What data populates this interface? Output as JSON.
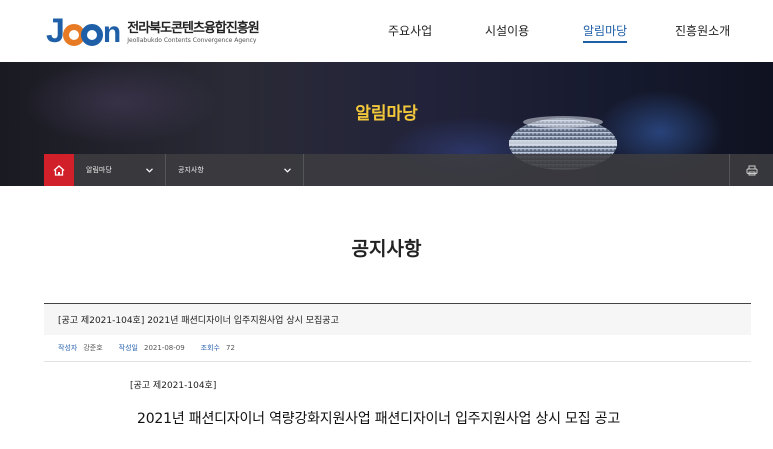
{
  "header": {
    "logo_korean": "전라북도콘텐츠융합진흥원",
    "logo_english": "Jeollabukdo Contents Convergence Agency",
    "nav": [
      {
        "label": "주요사업",
        "active": false
      },
      {
        "label": "시설이용",
        "active": false
      },
      {
        "label": "알림마당",
        "active": true
      },
      {
        "label": "진흥원소개",
        "active": false
      }
    ]
  },
  "banner": {
    "title": "알림마당"
  },
  "location": {
    "home_icon": "home-icon",
    "depth1": "알림마당",
    "depth2": "공지사항",
    "print_icon": "print-icon"
  },
  "page": {
    "title": "공지사항"
  },
  "post": {
    "subject": "[공고 제2021-104호] 2021년 패션디자이너 입주지원사업 상시 모집공고",
    "author_label": "작성자",
    "author": "강준호",
    "date_label": "작성일",
    "date": "2021-08-09",
    "views_label": "조회수",
    "views": "72",
    "body_notice_no": "[공고 제2021-104호]",
    "body_title": "2021년 패션디자이너 역량강화지원사업 패션디자이너 입주지원사업 상시 모집 공고"
  },
  "colors": {
    "brand_blue": "#1f5fa8",
    "brand_orange": "#e77b25",
    "banner_title": "#f3c83a",
    "home_red": "#d2202a"
  }
}
